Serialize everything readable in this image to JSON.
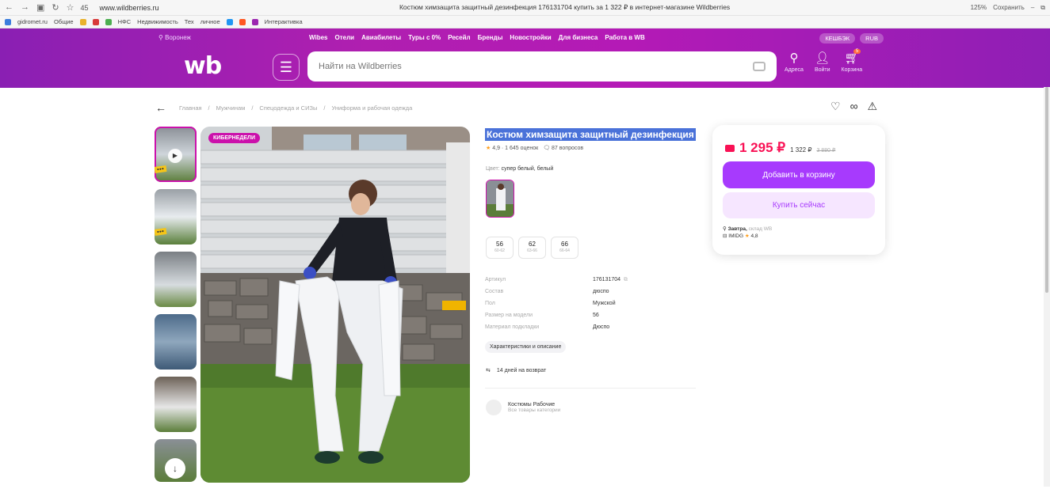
{
  "browser": {
    "zoom_label": "45",
    "url": "www.wildberries.ru",
    "tab_title": "Костюм химзащита защитный дезинфекция 176131704 купить за 1 322 ₽ в интернет-магазине Wildberries",
    "zoom_pct": "125%",
    "save_label": "Сохранить"
  },
  "bookmarks": [
    "gidromet.ru",
    "Общие",
    "НФС",
    "Недвижимость",
    "Тех",
    "личное",
    "Интерактивка"
  ],
  "header": {
    "city": "Воронеж",
    "links": [
      "Wibes",
      "Отели",
      "Авиабилеты",
      "Туры с 0%",
      "Ресейл",
      "Бренды",
      "Новостройки",
      "Для бизнеса",
      "Работа в WB"
    ],
    "cashback": "КЕШБЭК",
    "currency": "RUB",
    "logo": "wb",
    "search_placeholder": "Найти на Wildberries",
    "actions": [
      {
        "label": "Адреса",
        "icon": "location-icon"
      },
      {
        "label": "Войти",
        "icon": "user-icon"
      },
      {
        "label": "Корзина",
        "icon": "cart-icon"
      }
    ],
    "cart_count": "5"
  },
  "breadcrumbs": [
    "Главная",
    "Мужчинам",
    "Спецодежда и СИЗы",
    "Униформа и рабочая одежда"
  ],
  "product": {
    "badge": "КИБЕРНЕДЕЛИ",
    "title": "Костюм химзащита защитный дезинфекция",
    "rating": "4,9 · 1 645 оценок",
    "questions": "87 вопросов",
    "color_label": "Цвет:",
    "color_value": "супер белый, белый",
    "sizes": [
      {
        "size": "56",
        "range": "60-62"
      },
      {
        "size": "62",
        "range": "63-66"
      },
      {
        "size": "66",
        "range": "66-64"
      }
    ],
    "specs": [
      {
        "k": "Артикул",
        "v": "176131704"
      },
      {
        "k": "Состав",
        "v": "дюспо"
      },
      {
        "k": "Пол",
        "v": "Мужской"
      },
      {
        "k": "Размер на модели",
        "v": "56"
      },
      {
        "k": "Материал подкладки",
        "v": "Дюспо"
      }
    ],
    "char_button": "Характеристики и описание",
    "returns": "14 дней на возврат",
    "brand_name": "Костюмы Рабочие",
    "brand_sub": "Все товары категории"
  },
  "buy": {
    "price": "1 295 ₽",
    "price_card": "1 322 ₽",
    "price_old": "3 880 ₽",
    "add_to_cart": "Добавить в корзину",
    "buy_now": "Купить сейчас",
    "delivery": "Завтра,",
    "delivery_place": "склад WB",
    "seller": "IMIDG",
    "seller_rating": "4,8"
  },
  "colors": {
    "accent": "#cb11ab",
    "button": "#a73afd",
    "price": "#f91155"
  }
}
